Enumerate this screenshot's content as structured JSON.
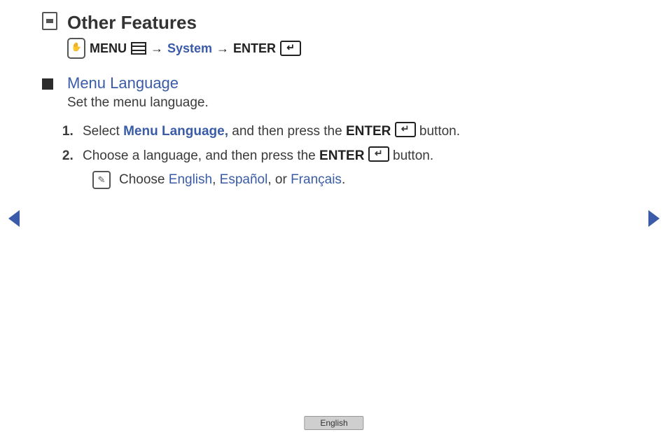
{
  "page": {
    "title": "Other Features"
  },
  "breadcrumb": {
    "menu_label": "MENU",
    "arrow1": "→",
    "system": "System",
    "arrow2": "→",
    "enter_label": "ENTER"
  },
  "section": {
    "title": "Menu Language",
    "desc": "Set the menu language."
  },
  "steps": {
    "s1": {
      "prefix": "Select ",
      "link": "Menu Language,",
      "mid": " and then press the ",
      "enter": "ENTER",
      "suffix": " button."
    },
    "s2": {
      "prefix": "Choose a language, and then press the ",
      "enter": "ENTER",
      "suffix": " button."
    }
  },
  "note": {
    "prefix": "Choose ",
    "lang1": "English",
    "sep1": ", ",
    "lang2": "Español",
    "sep2": ", or ",
    "lang3": "Français",
    "suffix": "."
  },
  "footer": {
    "language": "English"
  }
}
